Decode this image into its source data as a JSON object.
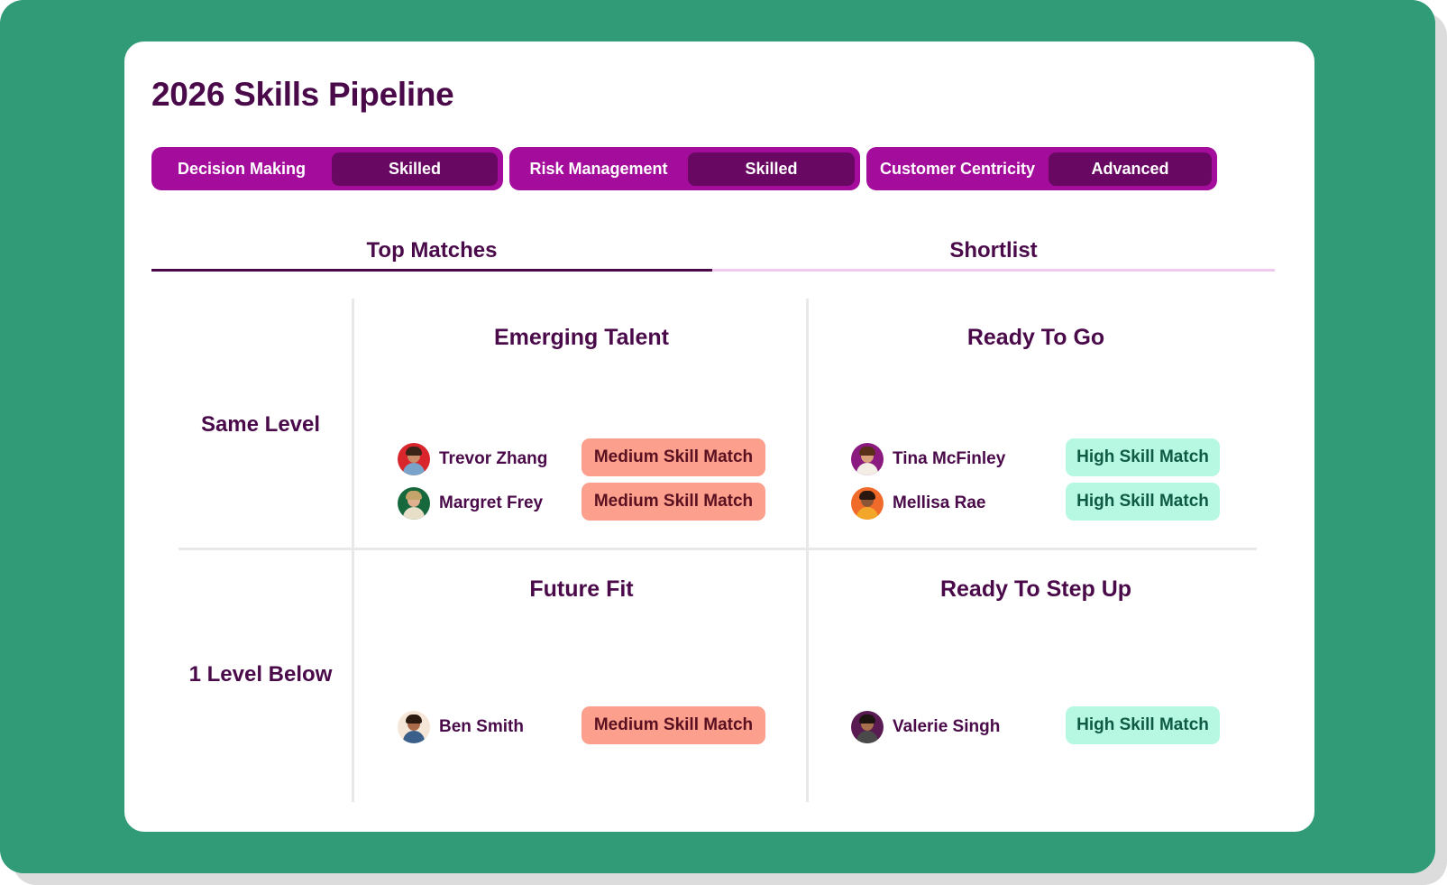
{
  "page_title": "2026 Skills Pipeline",
  "skill_pills": [
    {
      "skill": "Decision Making",
      "level": "Skilled"
    },
    {
      "skill": "Risk Management",
      "level": "Skilled"
    },
    {
      "skill": "Customer Centricity",
      "level": "Advanced"
    }
  ],
  "tabs": [
    {
      "label": "Top Matches",
      "active": true
    },
    {
      "label": "Shortlist",
      "active": false
    }
  ],
  "rows": [
    "Same Level",
    "1 Level Below"
  ],
  "quadrants": {
    "emerging_talent": {
      "title": "Emerging Talent",
      "people": [
        {
          "name": "Trevor Zhang",
          "match": "Medium Skill Match"
        },
        {
          "name": "Margret Frey",
          "match": "Medium Skill Match"
        }
      ]
    },
    "ready_to_go": {
      "title": "Ready To Go",
      "people": [
        {
          "name": "Tina McFinley",
          "match": "High Skill Match"
        },
        {
          "name": "Mellisa Rae",
          "match": "High Skill Match"
        }
      ]
    },
    "future_fit": {
      "title": "Future Fit",
      "people": [
        {
          "name": "Ben Smith",
          "match": "Medium Skill Match"
        }
      ]
    },
    "ready_to_step_up": {
      "title": "Ready To Step Up",
      "people": [
        {
          "name": "Valerie Singh",
          "match": "High Skill Match"
        }
      ]
    }
  },
  "colors": {
    "background": "#319a77",
    "title": "#4a0a4a",
    "pill": "#a40d9c",
    "pill_level": "#690863",
    "tab_active": "#4a0a4a",
    "tab_inactive": "#f0c9ee",
    "medium_match_bg": "#fca08d",
    "high_match_bg": "#b6f8e1"
  }
}
